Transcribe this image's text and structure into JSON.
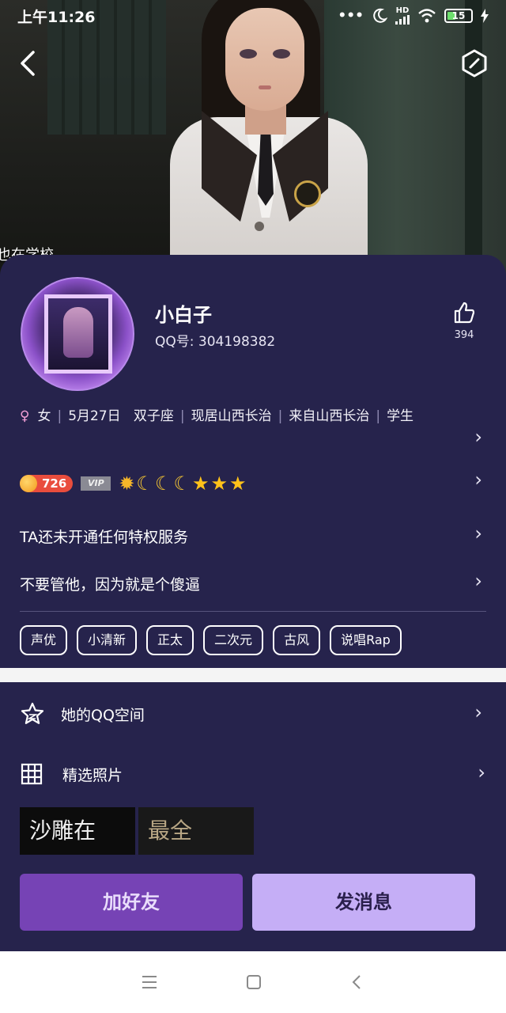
{
  "status_bar": {
    "time": "上午11:26",
    "signal": "•••",
    "net": "HD",
    "battery": "15"
  },
  "hero": {
    "caption": "也在学校"
  },
  "profile": {
    "name": "小白子",
    "qq_label": "QQ号: 304198382",
    "likes": "394",
    "info": {
      "gender": "女",
      "birthday": "5月27日",
      "zodiac": "双子座",
      "residence": "现居山西长治",
      "hometown": "来自山西长治",
      "job": "学生"
    },
    "level": {
      "coins": "726",
      "vip": "VIP",
      "icons": [
        "sun",
        "moon",
        "moon",
        "moon",
        "star",
        "star",
        "star"
      ]
    },
    "privilege": "TA还未开通任何特权服务",
    "signature": "不要管他，因为就是个傻逼",
    "tags": [
      "声优",
      "小清新",
      "正太",
      "二次元",
      "古风",
      "说唱Rap"
    ]
  },
  "links": {
    "qzone": "她的QQ空间",
    "photos": "精选照片"
  },
  "photos": [
    {
      "text": "沙雕在"
    },
    {
      "text": "最全"
    }
  ],
  "actions": {
    "add_friend": "加好友",
    "send_message": "发消息"
  },
  "colors": {
    "card_bg": "#26234c",
    "primary_button": "#7643b5",
    "secondary_button": "#c5aef6"
  }
}
